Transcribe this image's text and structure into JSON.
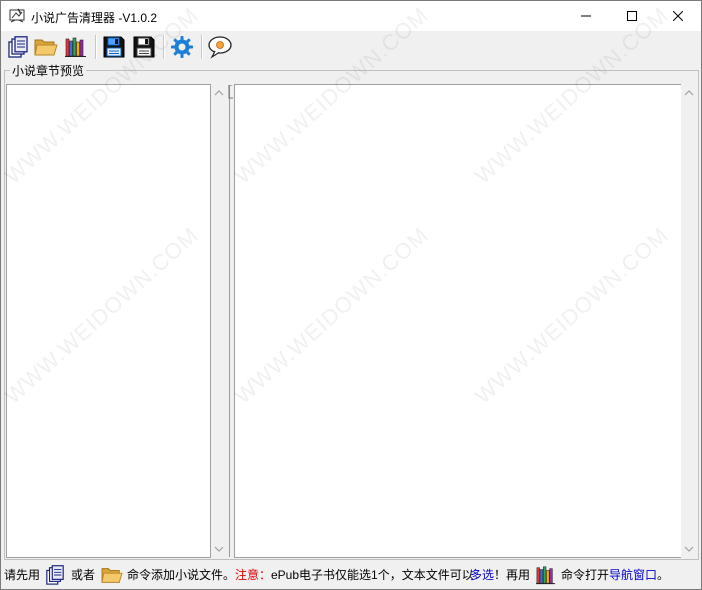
{
  "window": {
    "title": "小说广告清理器  -V1.0.2"
  },
  "toolbar": {
    "buttons": [
      {
        "name": "add-files-button",
        "icon": "pages-icon"
      },
      {
        "name": "open-folder-button",
        "icon": "folder-icon"
      },
      {
        "name": "navigation-button",
        "icon": "books-icon"
      },
      {
        "name": "save-blue-button",
        "icon": "save-blue-icon"
      },
      {
        "name": "save-button",
        "icon": "save-icon"
      },
      {
        "name": "settings-button",
        "icon": "gear-icon"
      },
      {
        "name": "about-button",
        "icon": "speech-bubble-icon"
      }
    ]
  },
  "preview": {
    "group_label": "小说章节预览"
  },
  "status": {
    "part1": "请先用",
    "part2": "或者",
    "part3": "命令添加小说文件。",
    "note_label": "注意：",
    "part4": "ePub电子书仅能选1个，文本文件可以",
    "multi": "多选",
    "part5": "！再用",
    "part6": "命令打开",
    "nav": "导航窗口",
    "part7": "。"
  },
  "watermark": {
    "text": "WWW.WEIDOWN.COM"
  },
  "colors": {
    "note": "#e00000",
    "link": "#0000cc",
    "gear": "#1e7fd6"
  }
}
